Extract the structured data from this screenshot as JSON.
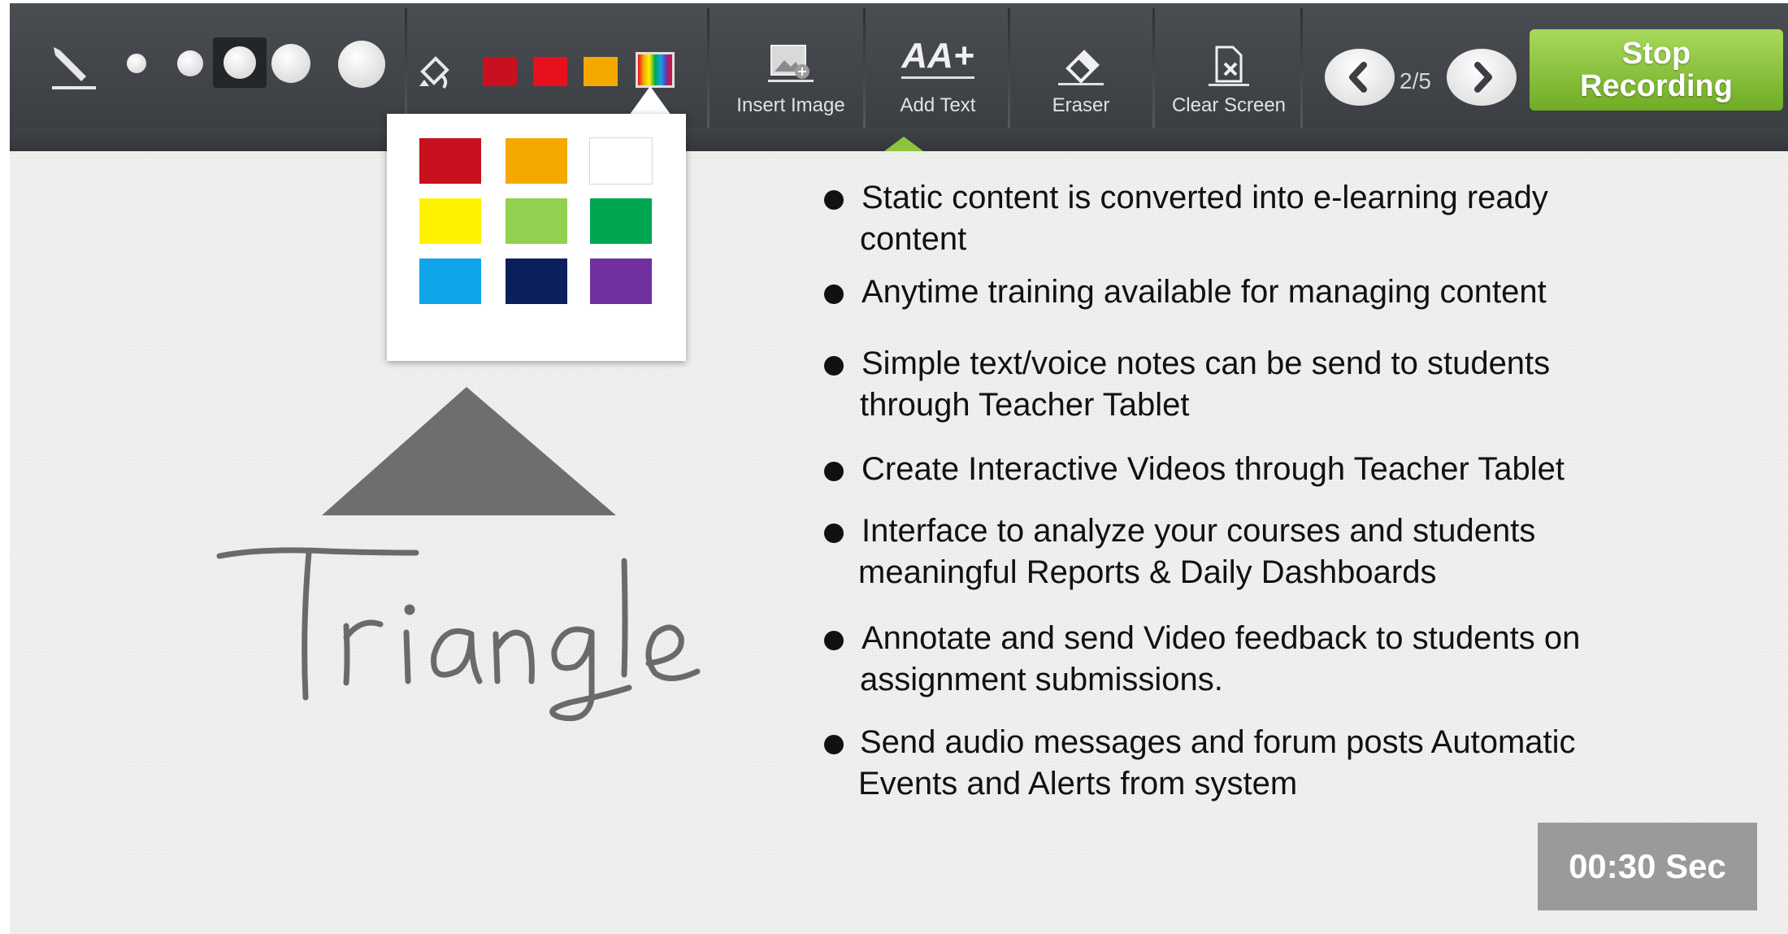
{
  "toolbar": {
    "pen_sizes": [
      "extra-small",
      "small",
      "medium",
      "large",
      "extra-large"
    ],
    "selected_pen_size": "medium",
    "quick_colors": [
      "#c8101e",
      "#e8101c",
      "#f5a900"
    ],
    "buttons": {
      "insert_image": "Insert Image",
      "add_text": "Add Text",
      "eraser": "Eraser",
      "clear_screen": "Clear Screen"
    },
    "add_text_icon": "AA+",
    "page_indicator": "2/5",
    "stop_recording_line1": "Stop",
    "stop_recording_line2": "Recording",
    "accent_color": "#8cc43f"
  },
  "palette": {
    "colors": [
      "#c8101e",
      "#f5a900",
      "#ffffff",
      "#fff200",
      "#92d050",
      "#00a651",
      "#0ea5e9",
      "#0a1f5c",
      "#7030a0"
    ]
  },
  "drawing": {
    "shape": "triangle",
    "handwritten_label": "Triangle"
  },
  "bullets": [
    {
      "line1": "Static content is converted into e-learning ready",
      "line2": "content"
    },
    {
      "line1": "Anytime training available for managing content",
      "line2": ""
    },
    {
      "line1": "Simple text/voice notes can be send to students",
      "line2": "through Teacher Tablet"
    },
    {
      "line1": "Create Interactive Videos through Teacher Tablet",
      "line2": ""
    },
    {
      "line1": "Interface to analyze your courses and students",
      "line2": "meaningful Reports & Daily Dashboards"
    },
    {
      "line1": "Annotate and send Video feedback to students on",
      "line2": "assignment submissions."
    },
    {
      "line1": "Send audio messages and forum posts Automatic",
      "line2": "Events and Alerts from system"
    }
  ],
  "timer": "00:30 Sec"
}
